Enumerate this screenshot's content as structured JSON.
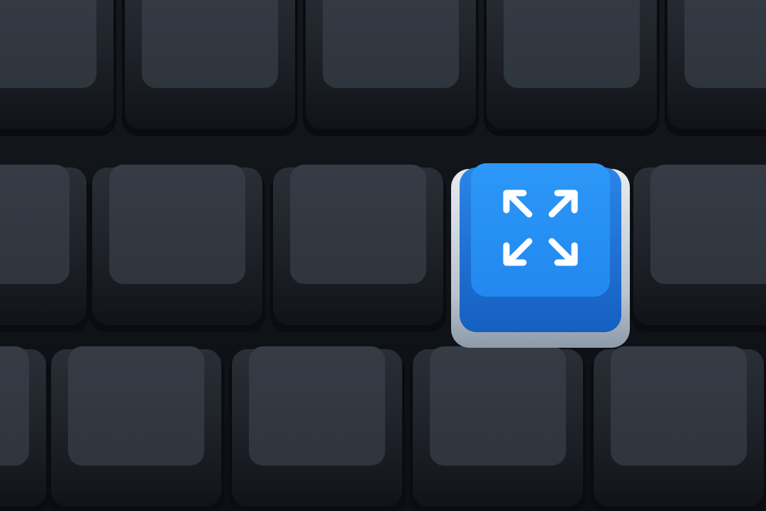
{
  "scene": {
    "subject": "keyboard-keys",
    "rows": 3,
    "keys_per_row": 5,
    "highlighted_key": {
      "row": 2,
      "column": 4,
      "icon": "fullscreen-expand-icon"
    }
  },
  "colors": {
    "background": "#0e1116",
    "key_cap_top": "#323840",
    "key_body": "#1b1f25",
    "key_highlight_top": "#2390f3",
    "key_highlight_body": "#1e6fd0",
    "key_highlight_base": "#b7c3cf",
    "icon": "#ffffff"
  }
}
